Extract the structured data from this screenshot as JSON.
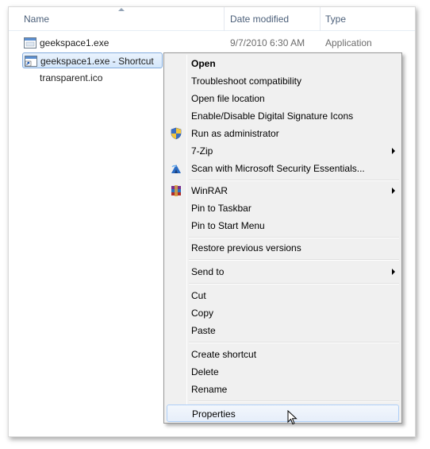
{
  "columns": {
    "name": "Name",
    "date_modified": "Date modified",
    "type": "Type"
  },
  "files": [
    {
      "name": "geekspace1.exe",
      "date": "9/7/2010 6:30 AM",
      "type": "Application",
      "icon": "exe-icon"
    },
    {
      "name": "geekspace1.exe - Shortcut",
      "icon": "shortcut-icon",
      "selected": true
    },
    {
      "name": "transparent.ico",
      "icon": "ico-file-icon"
    }
  ],
  "context_menu": {
    "items": {
      "open": "Open",
      "troubleshoot": "Troubleshoot compatibility",
      "open_location": "Open file location",
      "signature_icons": "Enable/Disable Digital Signature Icons",
      "run_admin": "Run as administrator",
      "zip": "7-Zip",
      "scan": "Scan with Microsoft Security Essentials...",
      "winrar": "WinRAR",
      "pin_taskbar": "Pin to Taskbar",
      "pin_start": "Pin to Start Menu",
      "restore": "Restore previous versions",
      "send_to": "Send to",
      "cut": "Cut",
      "copy": "Copy",
      "paste": "Paste",
      "create_shortcut": "Create shortcut",
      "delete": "Delete",
      "rename": "Rename",
      "properties": "Properties"
    },
    "hovered": "Properties"
  }
}
